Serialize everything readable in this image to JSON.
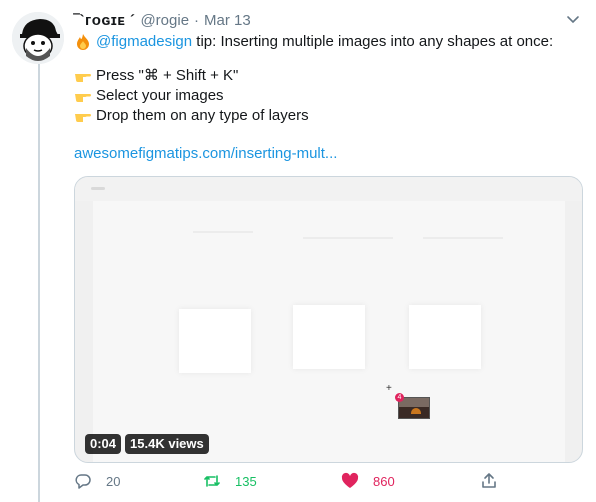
{
  "tweet": {
    "display_name": "‾`ᴦoɢɪᴇ ´",
    "handle": "@rogie",
    "separator": "·",
    "date": "Mar 13",
    "intro_mention": "@figmadesign",
    "intro_rest": " tip: Inserting multiple images into any shapes at once:",
    "steps": [
      "Press \"⌘ + Shift + K\"",
      "Select your images",
      "Drop them on any type of layers"
    ],
    "link": "awesomefigmatips.com/inserting-mult..."
  },
  "video": {
    "duration": "0:04",
    "views": "15.4K views"
  },
  "actions": {
    "replies": "20",
    "retweets": "135",
    "likes": "860"
  },
  "colors": {
    "link": "#1b95e0",
    "retweet": "#17bf63",
    "like": "#e0245e",
    "muted": "#657786"
  },
  "icons": {
    "fire": "fire-icon",
    "point": "pointing-hand-icon",
    "reply": "reply-icon",
    "retweet": "retweet-icon",
    "like": "heart-icon",
    "share": "share-icon",
    "menu": "chevron-down-icon"
  }
}
